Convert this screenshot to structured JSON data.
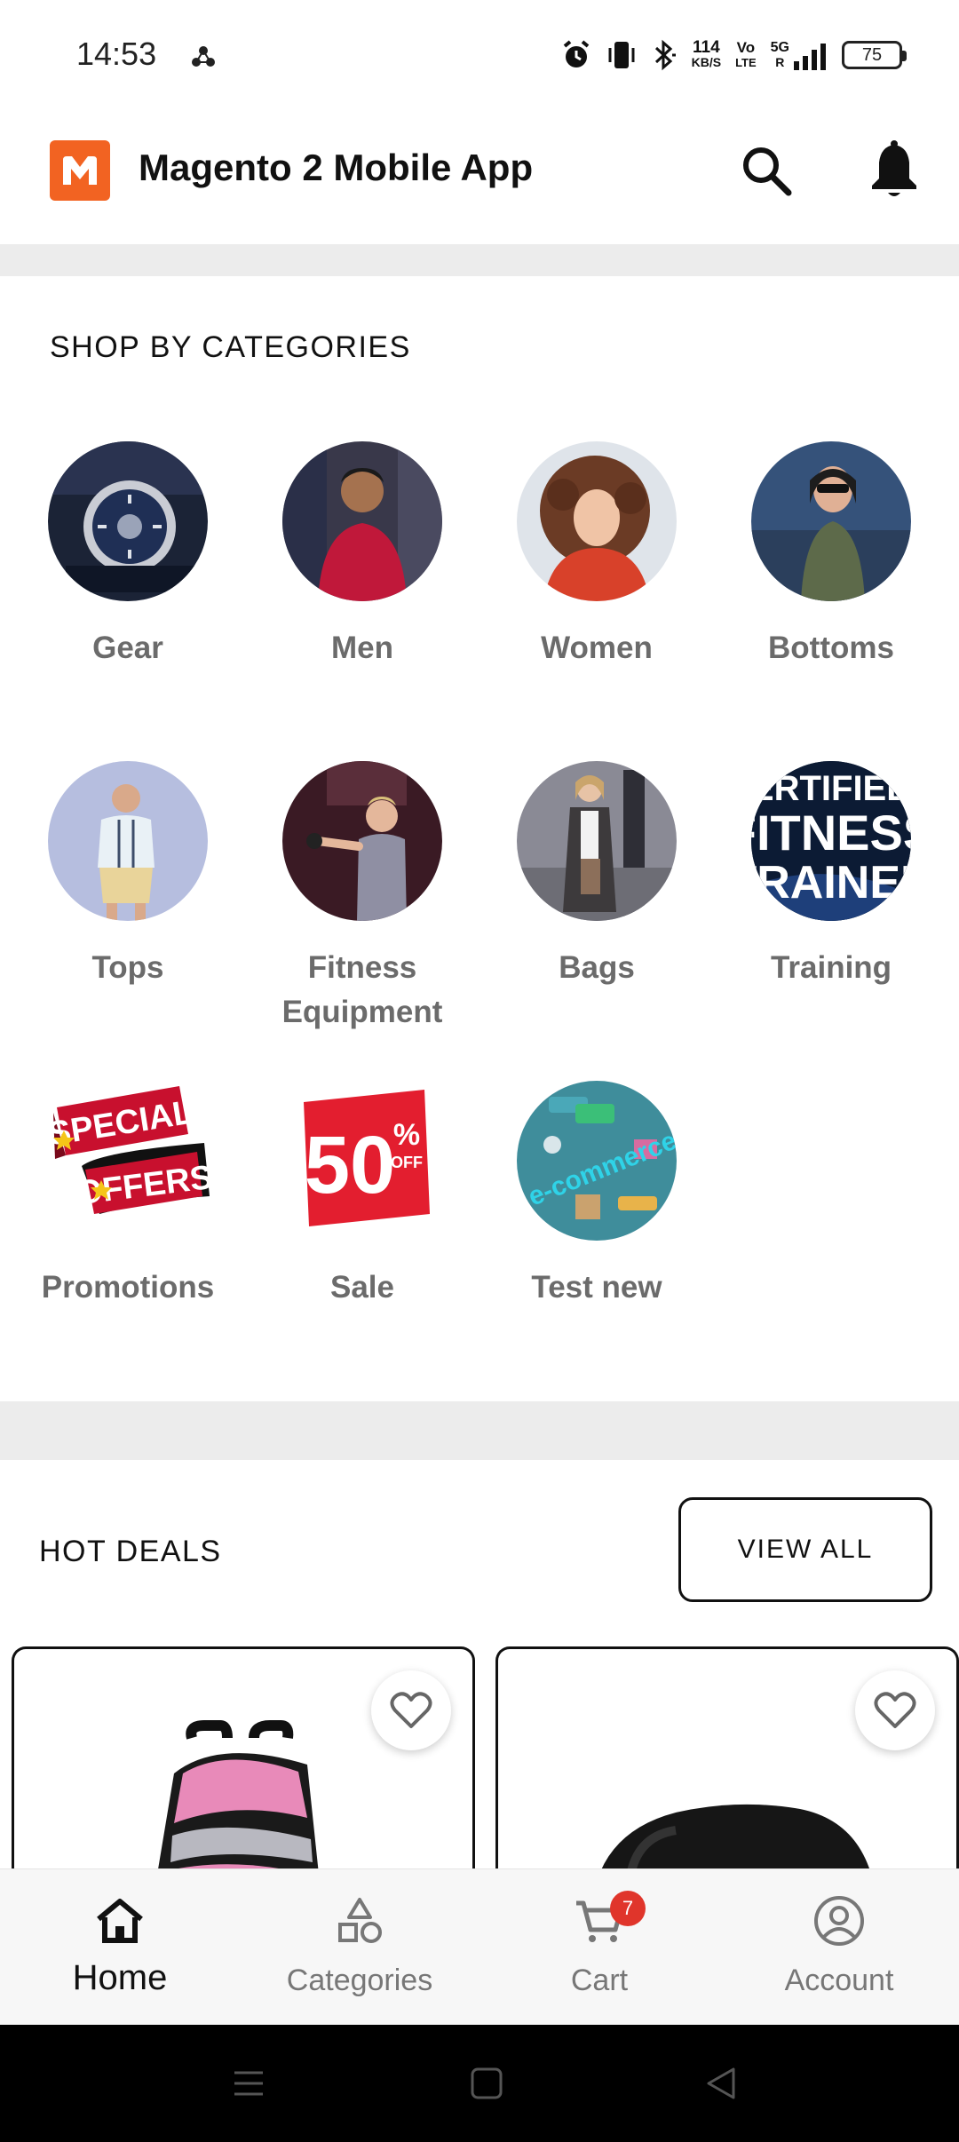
{
  "status_bar": {
    "time": "14:53",
    "net_speed": "114",
    "net_unit": "KB/S",
    "volte_top": "Vo",
    "volte_bottom": "LTE",
    "network": "5G",
    "battery": "75"
  },
  "header": {
    "title": "Magento 2 Mobile App",
    "logo_icon": "magento-logo-icon",
    "search_icon": "search-icon",
    "notification_icon": "bell-icon"
  },
  "categories": {
    "title": "SHOP BY CATEGORIES",
    "items": [
      {
        "label": "Gear"
      },
      {
        "label": "Men"
      },
      {
        "label": "Women"
      },
      {
        "label": "Bottoms"
      },
      {
        "label": "Tops"
      },
      {
        "label": "Fitness Equipment"
      },
      {
        "label": "Bags"
      },
      {
        "label": "Training"
      },
      {
        "label": "Promotions"
      },
      {
        "label": "Sale"
      },
      {
        "label": "Test new"
      }
    ],
    "image_text": {
      "training_line1": "ERTIFIED",
      "training_line2": "FITNESS",
      "training_line3": "TRAINER",
      "promo_line1": "SPECIAL",
      "promo_line2": "OFFERS",
      "sale_big": "50",
      "sale_small_pct": "%",
      "sale_small_off": "OFF",
      "ecommerce": "e-commerce"
    }
  },
  "hot_deals": {
    "title": "HOT DEALS",
    "view_all": "VIEW ALL"
  },
  "bottom_nav": {
    "items": [
      {
        "label": "Home",
        "icon": "home-icon",
        "active": true
      },
      {
        "label": "Categories",
        "icon": "categories-icon",
        "active": false
      },
      {
        "label": "Cart",
        "icon": "cart-icon",
        "active": false,
        "badge": "7"
      },
      {
        "label": "Account",
        "icon": "account-icon",
        "active": false
      }
    ]
  },
  "colors": {
    "brand": "#f26322",
    "badge": "#e0352b",
    "muted_text": "#6b6b6b"
  }
}
